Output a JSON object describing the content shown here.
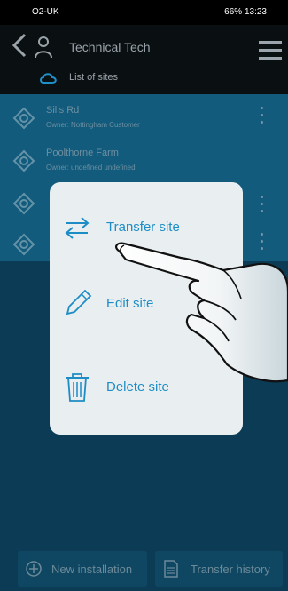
{
  "status_bar": {
    "left": "O2-UK",
    "right": "66%  13:23"
  },
  "header": {
    "title": "Technical Tech",
    "subtitle": "List of sites"
  },
  "sites": [
    {
      "name": "Sills Rd",
      "owner_prefix": "Owner:",
      "owner": "Nottingham Customer"
    },
    {
      "name": "Poolthorne Farm",
      "owner_prefix": "Owner:",
      "owner": "undefined undefined"
    },
    {
      "name": "",
      "owner_prefix": "",
      "owner": ""
    },
    {
      "name": "",
      "owner_prefix": "",
      "owner": ""
    }
  ],
  "popup": {
    "transfer": "Transfer site",
    "edit": "Edit site",
    "delete": "Delete site"
  },
  "bottom_buttons": {
    "new_installation": "New installation",
    "transfer_history": "Transfer history"
  },
  "colors": {
    "accent": "#1f8fc8",
    "list_bg": "#125b7c",
    "background": "#0c3c55"
  },
  "icons": [
    "back-icon",
    "person-icon",
    "menu-icon",
    "sites-icon",
    "site-icon",
    "more-icon",
    "transfer-icon",
    "edit-icon",
    "delete-icon",
    "add-circle-icon",
    "document-icon",
    "hand-pointer-icon"
  ]
}
